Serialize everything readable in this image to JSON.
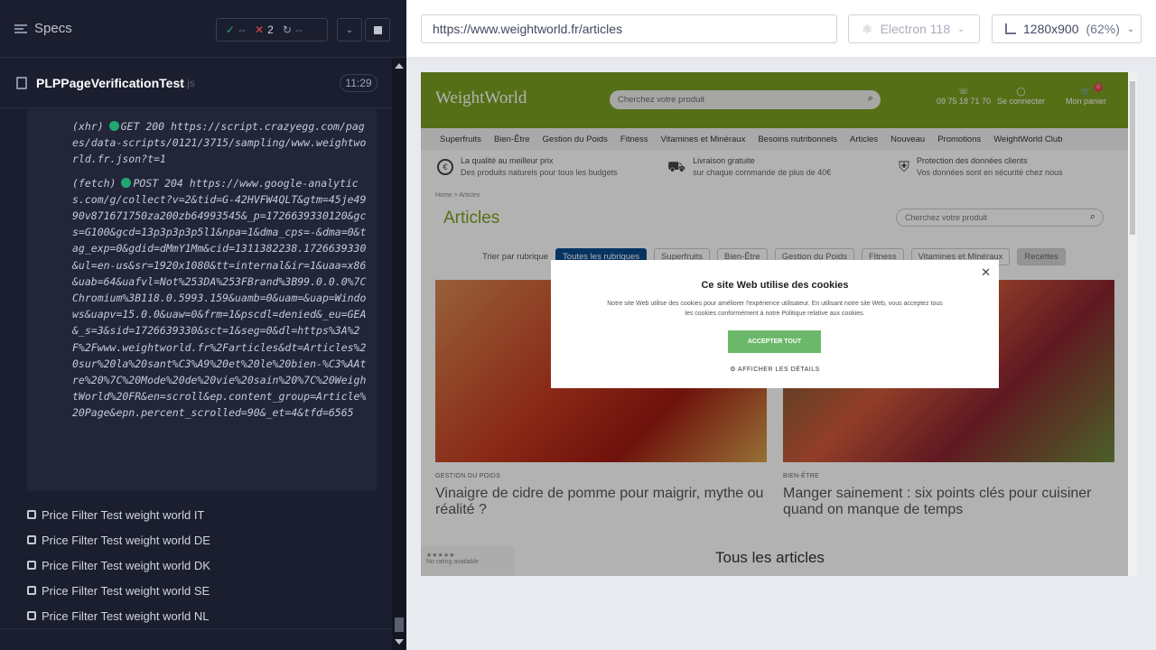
{
  "sidebar": {
    "title": "Specs",
    "stats": {
      "passed": "--",
      "failed": "2",
      "pending": "--"
    },
    "spec": {
      "name": "PLPPageVerificationTest",
      "ext": ".js",
      "time": "11:29"
    },
    "log": [
      {
        "type": "(xhr)",
        "method": "GET 200",
        "url": "https://script.crazyegg.com/pages/data-scripts/0121/3715/sampling/www.weightworld.fr.json?t=1"
      },
      {
        "type": "(fetch)",
        "method": "POST 204",
        "url": "https://www.google-analytics.com/g/collect?v=2&tid=G-42HVFW4QLT&gtm=45je4990v871671750za200zb64993545&_p=1726639330120&gcs=G100&gcd=13p3p3p3p5l1&npa=1&dma_cps=-&dma=0&tag_exp=0&gdid=dMmY1Mm&cid=1311382238.1726639330&ul=en-us&sr=1920x1080&tt=internal&ir=1&uaa=x86&uab=64&uafvl=Not%253DA%253FBrand%3B99.0.0.0%7CChromium%3B118.0.5993.159&uamb=0&uam=&uap=Windows&uapv=15.0.0&uaw=0&frm=1&pscdl=denied&_eu=GEA&_s=3&sid=1726639330&sct=1&seg=0&dl=https%3A%2F%2Fwww.weightworld.fr%2Farticles&dt=Articles%20sur%20la%20sant%C3%A9%20et%20le%20bien-%C3%AAtre%20%7C%20Mode%20de%20vie%20sain%20%7C%20WeightWorld%20FR&en=scroll&ep.content_group=Article%20Page&epn.percent_scrolled=90&_et=4&tfd=6565"
      }
    ],
    "tests": [
      "Price Filter Test weight world IT",
      "Price Filter Test weight world DE",
      "Price Filter Test weight world DK",
      "Price Filter Test weight world SE",
      "Price Filter Test weight world NL"
    ]
  },
  "toolbar": {
    "url": "https://www.weightworld.fr/articles",
    "browser": "Electron 118",
    "viewport": "1280x900",
    "zoom": "(62%)"
  },
  "site": {
    "logo": "WeightWorld",
    "search_placeholder": "Cherchez votre produit",
    "phone": "09 75 18 71 70",
    "login": "Se connecter",
    "cart": "Mon panier",
    "cart_count": "0",
    "nav": [
      "Superfruits",
      "Bien-Être",
      "Gestion du Poids",
      "Fitness",
      "Vitamines et Minéraux",
      "Besoins nutritionnels",
      "Articles",
      "Nouveau",
      "Promotions",
      "WeightWorld Club"
    ],
    "promos": [
      {
        "title": "La qualité au meilleur prix",
        "sub": "Des produits naturels pour tous les budgets"
      },
      {
        "title": "Livraison gratuite",
        "sub": "sur chaque commande de plus de 40€"
      },
      {
        "title": "Protection des données clients",
        "sub": "Vos données sont en sécurité chez nous"
      }
    ],
    "breadcrumb": {
      "home": "Home",
      "sep": ">",
      "current": "Articles"
    },
    "page_title": "Articles",
    "sort_label": "Trier par rubrique",
    "filters": [
      "Toutes les rubriques",
      "Superfruits",
      "Bien-Être",
      "Gestion du Poids",
      "Fitness",
      "Vitamines et Minéraux",
      "Recettes"
    ],
    "articles": [
      {
        "category": "GESTION DU POIDS",
        "title": "Vinaigre de cidre de pomme pour maigrir, mythe ou réalité ?"
      },
      {
        "category": "BIEN-ÊTRE",
        "title": "Manger sainement : six points clés pour cuisiner quand on manque de temps"
      }
    ],
    "rating": "No rating available",
    "all_articles": "Tous les articles",
    "cookie": {
      "title": "Ce site Web utilise des cookies",
      "text": "Notre site Web utilise des cookies pour améliorer l'expérience utilisateur. En utilisant notre site Web, vous acceptez tous les cookies conformément à notre Politique relative aux cookies.",
      "accept": "ACCEPTER TOUT",
      "details": "AFFICHER LES DÉTAILS"
    }
  }
}
